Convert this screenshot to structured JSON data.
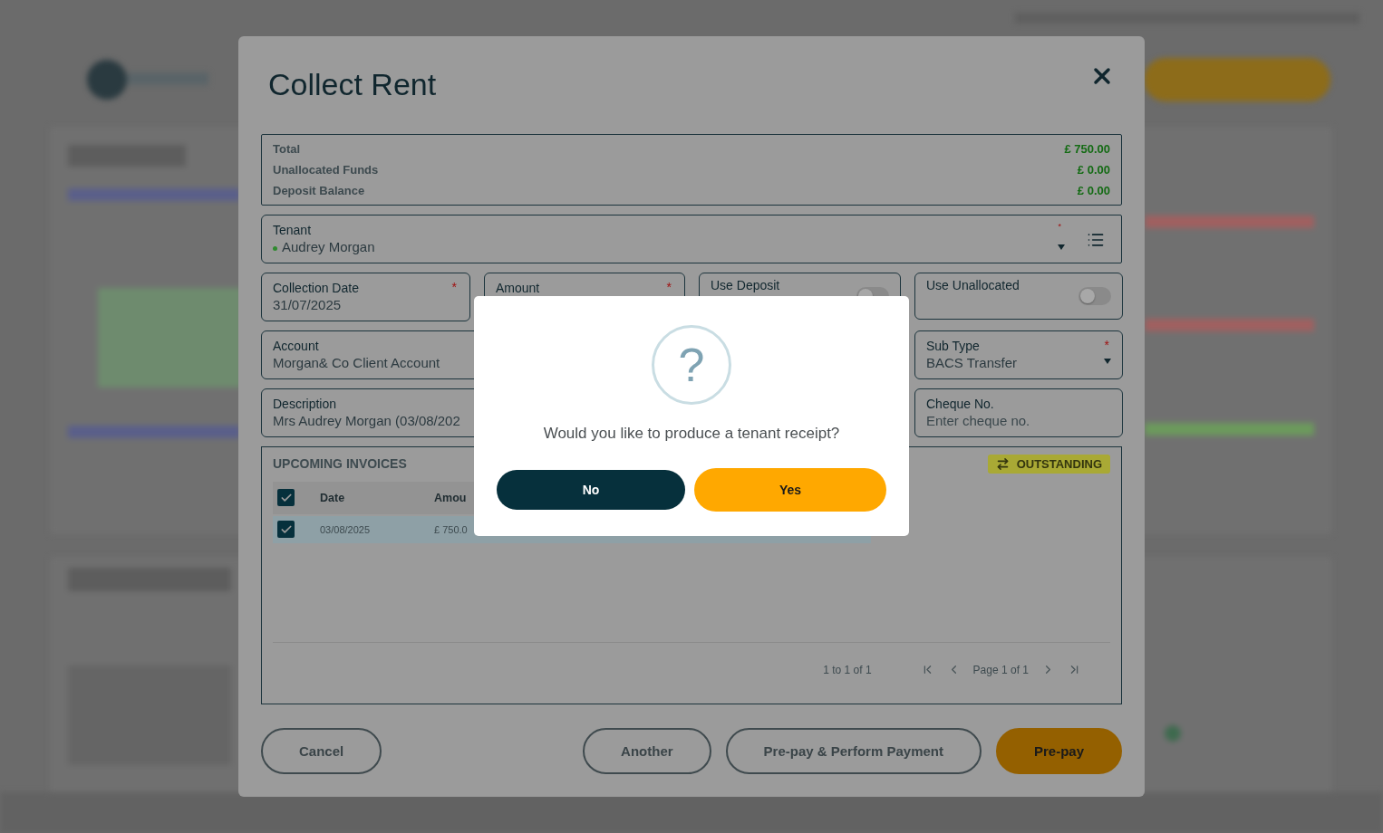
{
  "modal": {
    "title": "Collect Rent"
  },
  "required_mark": "*",
  "summary": [
    {
      "label": "Total",
      "value": "£ 750.00"
    },
    {
      "label": "Unallocated Funds",
      "value": "£ 0.00"
    },
    {
      "label": "Deposit Balance",
      "value": "£ 0.00"
    }
  ],
  "tenant": {
    "label": "Tenant",
    "value": "Audrey Morgan",
    "required": true,
    "color": "#2f8a2f"
  },
  "field_rows": [
    [
      {
        "kind": "input",
        "label": "Collection Date",
        "value": "31/07/2025",
        "required": true
      },
      {
        "kind": "input",
        "label": "Amount",
        "required": true
      },
      {
        "kind": "toggle",
        "label": "Use Deposit",
        "on": false
      },
      {
        "kind": "toggle",
        "label": "Use Unallocated",
        "on": false
      }
    ],
    [
      {
        "kind": "input",
        "label": "Account",
        "value": "Morgan& Co Client Account"
      },
      {
        "kind": "select",
        "label": "Sub Type",
        "value": "BACS Transfer",
        "required": true
      }
    ],
    [
      {
        "kind": "input",
        "label": "Description",
        "value": "Mrs Audrey Morgan (03/08/202"
      },
      {
        "kind": "input",
        "label": "Cheque No.",
        "placeholder": "Enter cheque no.",
        "required": false
      }
    ]
  ],
  "invoices": {
    "title": "UPCOMING INVOICES",
    "badge": "OUTSTANDING",
    "all_checked": true,
    "columns": [
      "Date",
      "Amou"
    ],
    "rows": [
      {
        "cells": [
          "03/08/2025",
          "£ 750.0"
        ],
        "checked": true,
        "selected": true
      }
    ],
    "range": "1 to 1 of 1",
    "page": "Page 1 of 1"
  },
  "footer_buttons": [
    {
      "label": "Cancel",
      "kind": "outline"
    },
    {
      "label": "Another",
      "kind": "outline"
    },
    {
      "label": "Pre-pay & Perform Payment",
      "kind": "outline"
    },
    {
      "label": "Pre-pay",
      "kind": "primary"
    }
  ],
  "dialog": {
    "icon_glyph": "?",
    "message": "Would you like to produce a tenant receipt?",
    "buttons": [
      {
        "label": "No",
        "kind": "secondary"
      },
      {
        "label": "Yes",
        "kind": "primary"
      }
    ]
  }
}
